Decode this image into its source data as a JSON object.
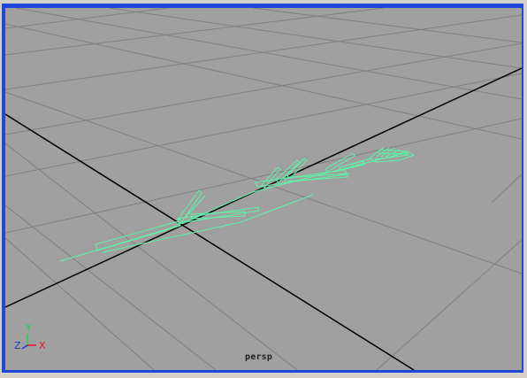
{
  "viewport": {
    "camera_label": "persp",
    "background_color": "#a0a0a0",
    "grid_color": "#808080",
    "axis_line_color": "#000000",
    "frame_color": "#1f48d8",
    "selection_color": "#5cf3a8"
  },
  "axis_gizmo": {
    "x_label": "X",
    "y_label": "Y",
    "z_label": "Z",
    "x_color": "#e21818",
    "y_color": "#22d04c",
    "z_color": "#2030d0"
  },
  "model": {
    "icon": "wireframe-plant-model"
  }
}
